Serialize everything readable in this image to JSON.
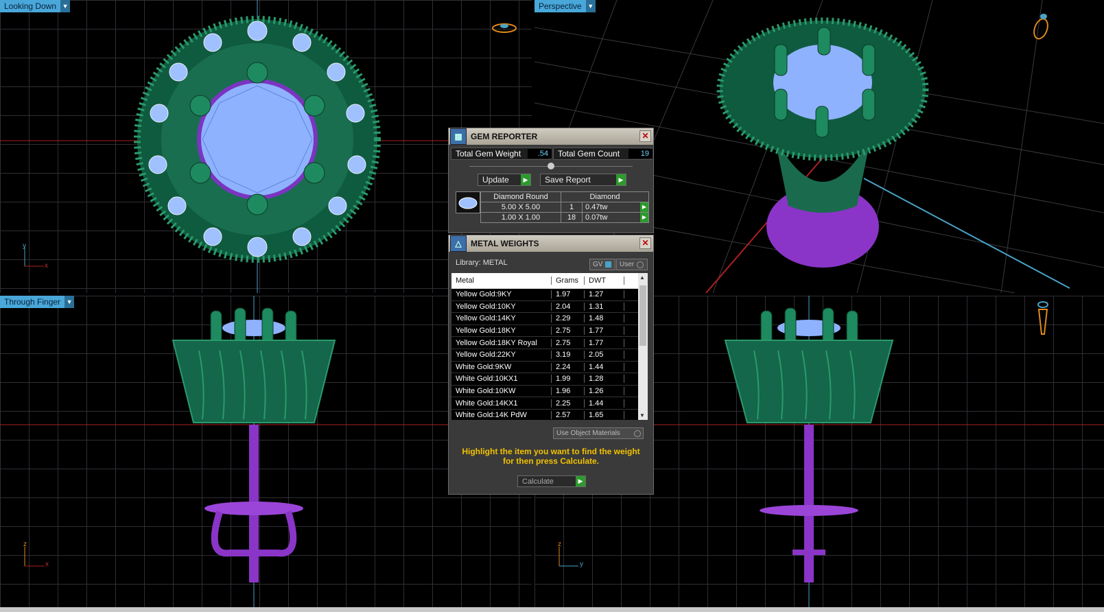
{
  "viewports": {
    "top_left": {
      "label": "Looking Down",
      "axes": [
        "y",
        "x"
      ]
    },
    "top_right": {
      "label": "Perspective"
    },
    "bottom_left": {
      "label": "Through Finger",
      "axes": [
        "z",
        "x"
      ]
    },
    "bottom_right": {
      "axes": [
        "z",
        "y"
      ]
    }
  },
  "colors": {
    "grid": "#2f2f36",
    "label_bg": "#49a7d9",
    "model_green": "#1f7a57",
    "model_purple": "#8a35c8",
    "gem_blue": "#8fb2ff"
  },
  "gem_reporter": {
    "title": "GEM REPORTER",
    "close_label": "✕",
    "total_weight_label": "Total Gem Weight",
    "total_weight_value": ".54",
    "total_count_label": "Total Gem Count",
    "total_count_value": "19",
    "update_label": "Update",
    "save_label": "Save Report",
    "header": {
      "shape": "Diamond Round",
      "type": "Diamond"
    },
    "rows": [
      {
        "size": "5.00 X 5.00",
        "count": "1",
        "weight": "0.47tw"
      },
      {
        "size": "1.00 X 1.00",
        "count": "18",
        "weight": "0.07tw"
      }
    ]
  },
  "metal_weights": {
    "title": "METAL WEIGHTS",
    "close_label": "✕",
    "library_label": "Library: METAL",
    "gv_label": "GV",
    "user_label": "User",
    "columns": [
      "Metal",
      "Grams",
      "DWT"
    ],
    "rows": [
      {
        "metal": "Yellow Gold:9KY",
        "grams": "1.97",
        "dwt": "1.27"
      },
      {
        "metal": "Yellow Gold:10KY",
        "grams": "2.04",
        "dwt": "1.31"
      },
      {
        "metal": "Yellow Gold:14KY",
        "grams": "2.29",
        "dwt": "1.48"
      },
      {
        "metal": "Yellow Gold:18KY",
        "grams": "2.75",
        "dwt": "1.77"
      },
      {
        "metal": "Yellow Gold:18KY Royal",
        "grams": "2.75",
        "dwt": "1.77"
      },
      {
        "metal": "Yellow Gold:22KY",
        "grams": "3.19",
        "dwt": "2.05"
      },
      {
        "metal": "White Gold:9KW",
        "grams": "2.24",
        "dwt": "1.44"
      },
      {
        "metal": "White Gold:10KX1",
        "grams": "1.99",
        "dwt": "1.28"
      },
      {
        "metal": "White Gold:10KW",
        "grams": "1.96",
        "dwt": "1.26"
      },
      {
        "metal": "White Gold:14KX1",
        "grams": "2.25",
        "dwt": "1.44"
      },
      {
        "metal": "White Gold:14K PdW",
        "grams": "2.57",
        "dwt": "1.65"
      }
    ],
    "use_object_materials_label": "Use Object Materials",
    "hint": "Highlight the item you want to find the weight for then press Calculate.",
    "calculate_label": "Calculate"
  }
}
